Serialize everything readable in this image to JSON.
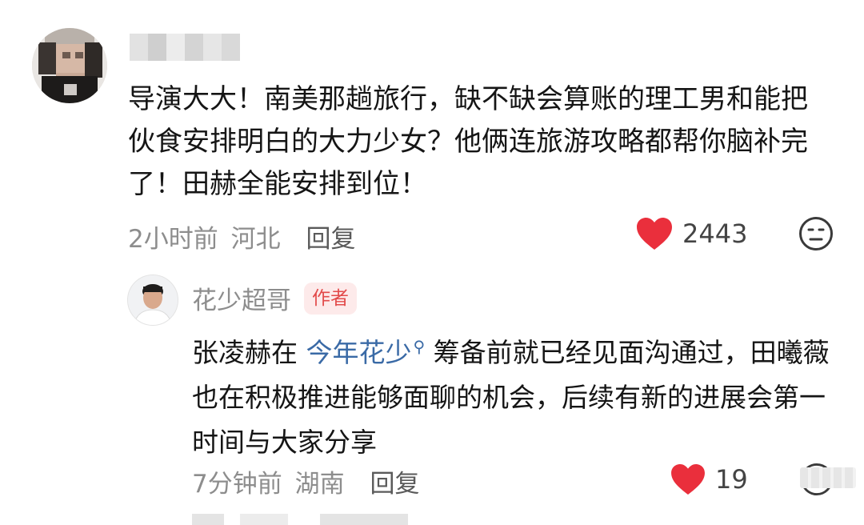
{
  "comment": {
    "text": "导演大大！南美那趟旅行，缺不缺会算账的理工男和能把伙食安排明白的大力少女？他俩连旅游攻略都帮你脑补完了！田赫全能安排到位！",
    "time": "2小时前",
    "location": "河北",
    "reply_label": "回复",
    "like_count": "2443"
  },
  "reply": {
    "author_name": "花少超哥",
    "author_badge": "作者",
    "text_before": "张凌赫在 ",
    "topic_link": "今年花少",
    "text_after": " 筹备前就已经见面沟通过，田曦薇也在积极推进能够面聊的机会，后续有新的进展会第一时间与大家分享",
    "time": "7分钟前",
    "location": "湖南",
    "reply_label": "回复",
    "like_count": "19"
  },
  "colors": {
    "heart": "#ea2f3c",
    "link": "#3a6aa6",
    "badge_bg": "#fdeaea",
    "badge_text": "#e24a4a",
    "meta": "#8d8d8d"
  },
  "icons": {
    "like": "heart-icon",
    "dislike": "neutral-face-icon",
    "topic": "search-icon"
  }
}
